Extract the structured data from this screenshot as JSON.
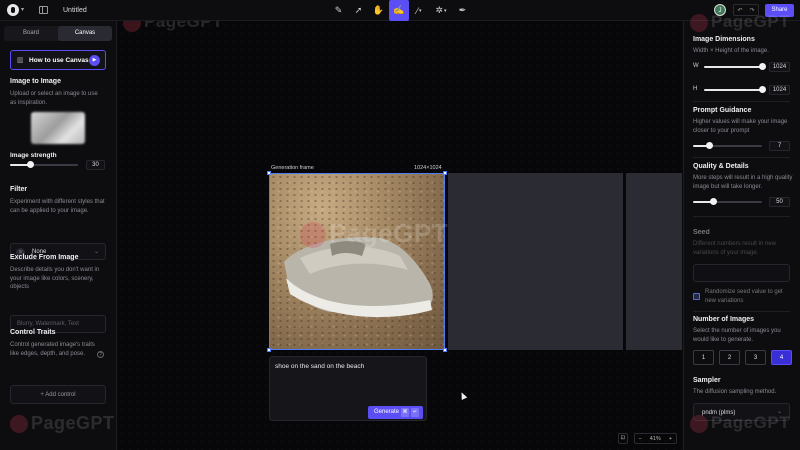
{
  "topbar": {
    "title": "Untitled",
    "avatar_initial": "J",
    "share_label": "Share",
    "tools": [
      "magic-pencil-icon",
      "select-arrow-icon",
      "hand-icon",
      "canvas-edit-icon",
      "brush-icon",
      "stamp-icon",
      "pen-icon"
    ],
    "active_tool": "canvas-edit-icon"
  },
  "left": {
    "tabs": [
      {
        "label": "Board"
      },
      {
        "label": "Canvas"
      }
    ],
    "active_tab": "Canvas",
    "howto_label": "How to use Canvas",
    "image_to_image": {
      "title": "Image to Image",
      "desc": "Upload or select an image to use as inspiration."
    },
    "image_strength": {
      "label": "Image strength",
      "value": "30"
    },
    "filter": {
      "title": "Filter",
      "desc": "Experiment with different styles that can be applied to your image.",
      "value": "None"
    },
    "exclude": {
      "title": "Exclude From Image",
      "desc": "Describe details you don't want in your image like colors, scenery, objects",
      "placeholder": "Blurry, Watermark, Text"
    },
    "control_traits": {
      "title": "Control Traits",
      "desc": "Control generated image's traits like edges, depth, and pose.",
      "add_label": "+ Add control"
    }
  },
  "canvas": {
    "frame_label": "Generation frame",
    "frame_size": "1024×1024",
    "prompt": "shoe on the sand on the beach",
    "generate_label": "Generate",
    "kbd1": "⌘",
    "kbd2": "↵",
    "zoom": "41%"
  },
  "right": {
    "dimensions": {
      "title": "Image Dimensions",
      "desc": "Width × Height of the image.",
      "width_label": "W",
      "width": "1024",
      "height_label": "H",
      "height": "1024"
    },
    "prompt_guidance": {
      "title": "Prompt Guidance",
      "desc": "Higher values will make your image closer to your prompt",
      "value": "7"
    },
    "quality": {
      "title": "Quality & Details",
      "desc": "More steps will result in a high quality image but will take longer.",
      "value": "50"
    },
    "seed": {
      "title": "Seed",
      "desc": "Different numbers result in new variations of your image.",
      "randomize_label": "Randomize seed value to get new variations"
    },
    "num_images": {
      "title": "Number of Images",
      "desc": "Select the number of images you would like to generate.",
      "options": [
        "1",
        "2",
        "3",
        "4"
      ],
      "selected": "4"
    },
    "sampler": {
      "title": "Sampler",
      "desc": "The diffusion sampling method.",
      "value": "pndm (plms)"
    }
  },
  "watermark": "PageGPT"
}
